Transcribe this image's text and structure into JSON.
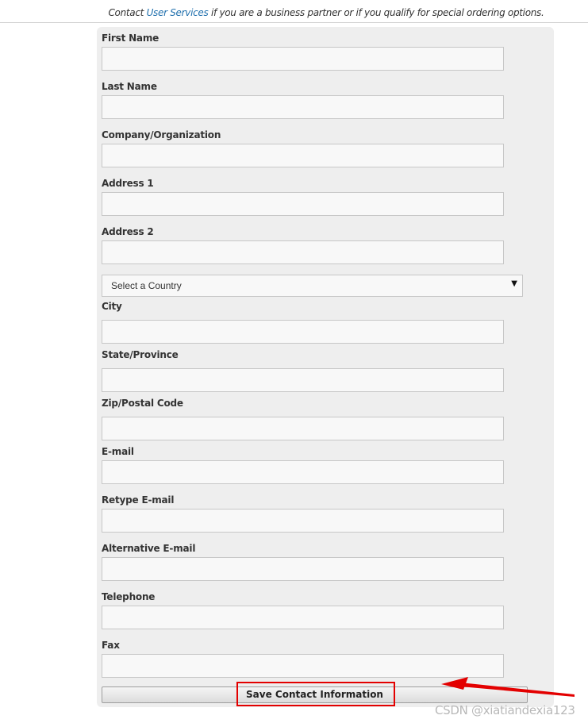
{
  "notice": {
    "prefix": "Contact ",
    "link_text": "User Services",
    "suffix": " if you are a business partner or if you qualify for special ordering options."
  },
  "form": {
    "fields": [
      {
        "label": "First Name",
        "value": ""
      },
      {
        "label": "Last Name",
        "value": ""
      },
      {
        "label": "Company/Organization",
        "value": ""
      },
      {
        "label": "Address 1",
        "value": ""
      },
      {
        "label": "Address 2",
        "value": ""
      },
      {
        "label": "City",
        "value": ""
      },
      {
        "label": "State/Province",
        "value": ""
      },
      {
        "label": "Zip/Postal Code",
        "value": ""
      },
      {
        "label": "E-mail",
        "value": ""
      },
      {
        "label": "Retype E-mail",
        "value": ""
      },
      {
        "label": "Alternative E-mail",
        "value": ""
      },
      {
        "label": "Telephone",
        "value": ""
      },
      {
        "label": "Fax",
        "value": ""
      }
    ],
    "country_select": {
      "selected": "Select a Country",
      "arrow_icon": "▼"
    },
    "save_button_label": "Save Contact Information"
  },
  "annotation": {
    "highlight_color": "#e30000"
  },
  "watermark": "CSDN @xiatiandexia123"
}
